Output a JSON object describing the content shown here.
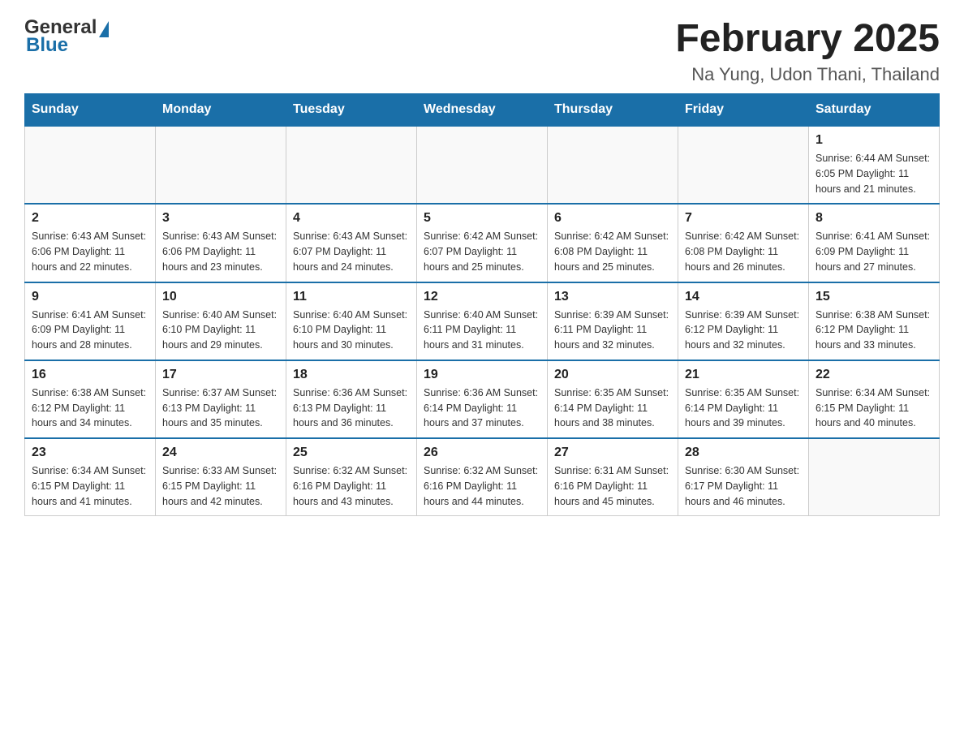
{
  "header": {
    "logo_general": "General",
    "logo_blue": "Blue",
    "month_title": "February 2025",
    "location": "Na Yung, Udon Thani, Thailand"
  },
  "weekdays": [
    "Sunday",
    "Monday",
    "Tuesday",
    "Wednesday",
    "Thursday",
    "Friday",
    "Saturday"
  ],
  "weeks": [
    [
      {
        "day": "",
        "info": ""
      },
      {
        "day": "",
        "info": ""
      },
      {
        "day": "",
        "info": ""
      },
      {
        "day": "",
        "info": ""
      },
      {
        "day": "",
        "info": ""
      },
      {
        "day": "",
        "info": ""
      },
      {
        "day": "1",
        "info": "Sunrise: 6:44 AM\nSunset: 6:05 PM\nDaylight: 11 hours and 21 minutes."
      }
    ],
    [
      {
        "day": "2",
        "info": "Sunrise: 6:43 AM\nSunset: 6:06 PM\nDaylight: 11 hours and 22 minutes."
      },
      {
        "day": "3",
        "info": "Sunrise: 6:43 AM\nSunset: 6:06 PM\nDaylight: 11 hours and 23 minutes."
      },
      {
        "day": "4",
        "info": "Sunrise: 6:43 AM\nSunset: 6:07 PM\nDaylight: 11 hours and 24 minutes."
      },
      {
        "day": "5",
        "info": "Sunrise: 6:42 AM\nSunset: 6:07 PM\nDaylight: 11 hours and 25 minutes."
      },
      {
        "day": "6",
        "info": "Sunrise: 6:42 AM\nSunset: 6:08 PM\nDaylight: 11 hours and 25 minutes."
      },
      {
        "day": "7",
        "info": "Sunrise: 6:42 AM\nSunset: 6:08 PM\nDaylight: 11 hours and 26 minutes."
      },
      {
        "day": "8",
        "info": "Sunrise: 6:41 AM\nSunset: 6:09 PM\nDaylight: 11 hours and 27 minutes."
      }
    ],
    [
      {
        "day": "9",
        "info": "Sunrise: 6:41 AM\nSunset: 6:09 PM\nDaylight: 11 hours and 28 minutes."
      },
      {
        "day": "10",
        "info": "Sunrise: 6:40 AM\nSunset: 6:10 PM\nDaylight: 11 hours and 29 minutes."
      },
      {
        "day": "11",
        "info": "Sunrise: 6:40 AM\nSunset: 6:10 PM\nDaylight: 11 hours and 30 minutes."
      },
      {
        "day": "12",
        "info": "Sunrise: 6:40 AM\nSunset: 6:11 PM\nDaylight: 11 hours and 31 minutes."
      },
      {
        "day": "13",
        "info": "Sunrise: 6:39 AM\nSunset: 6:11 PM\nDaylight: 11 hours and 32 minutes."
      },
      {
        "day": "14",
        "info": "Sunrise: 6:39 AM\nSunset: 6:12 PM\nDaylight: 11 hours and 32 minutes."
      },
      {
        "day": "15",
        "info": "Sunrise: 6:38 AM\nSunset: 6:12 PM\nDaylight: 11 hours and 33 minutes."
      }
    ],
    [
      {
        "day": "16",
        "info": "Sunrise: 6:38 AM\nSunset: 6:12 PM\nDaylight: 11 hours and 34 minutes."
      },
      {
        "day": "17",
        "info": "Sunrise: 6:37 AM\nSunset: 6:13 PM\nDaylight: 11 hours and 35 minutes."
      },
      {
        "day": "18",
        "info": "Sunrise: 6:36 AM\nSunset: 6:13 PM\nDaylight: 11 hours and 36 minutes."
      },
      {
        "day": "19",
        "info": "Sunrise: 6:36 AM\nSunset: 6:14 PM\nDaylight: 11 hours and 37 minutes."
      },
      {
        "day": "20",
        "info": "Sunrise: 6:35 AM\nSunset: 6:14 PM\nDaylight: 11 hours and 38 minutes."
      },
      {
        "day": "21",
        "info": "Sunrise: 6:35 AM\nSunset: 6:14 PM\nDaylight: 11 hours and 39 minutes."
      },
      {
        "day": "22",
        "info": "Sunrise: 6:34 AM\nSunset: 6:15 PM\nDaylight: 11 hours and 40 minutes."
      }
    ],
    [
      {
        "day": "23",
        "info": "Sunrise: 6:34 AM\nSunset: 6:15 PM\nDaylight: 11 hours and 41 minutes."
      },
      {
        "day": "24",
        "info": "Sunrise: 6:33 AM\nSunset: 6:15 PM\nDaylight: 11 hours and 42 minutes."
      },
      {
        "day": "25",
        "info": "Sunrise: 6:32 AM\nSunset: 6:16 PM\nDaylight: 11 hours and 43 minutes."
      },
      {
        "day": "26",
        "info": "Sunrise: 6:32 AM\nSunset: 6:16 PM\nDaylight: 11 hours and 44 minutes."
      },
      {
        "day": "27",
        "info": "Sunrise: 6:31 AM\nSunset: 6:16 PM\nDaylight: 11 hours and 45 minutes."
      },
      {
        "day": "28",
        "info": "Sunrise: 6:30 AM\nSunset: 6:17 PM\nDaylight: 11 hours and 46 minutes."
      },
      {
        "day": "",
        "info": ""
      }
    ]
  ]
}
